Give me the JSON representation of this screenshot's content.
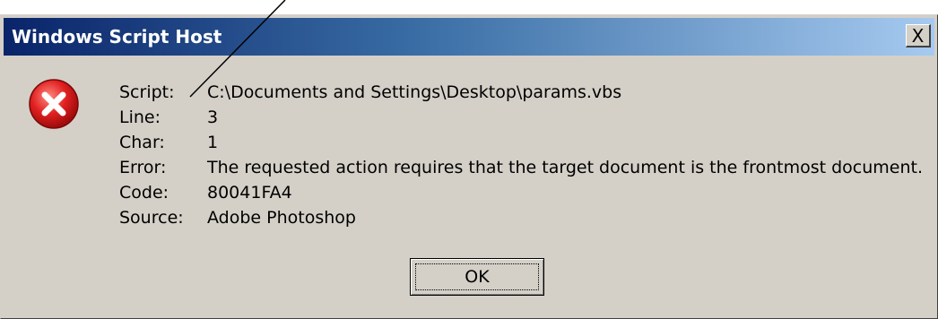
{
  "window": {
    "title": "Windows Script Host",
    "close_label": "X"
  },
  "icon": "error-icon",
  "details": [
    {
      "label": "Script:",
      "value": "C:\\Documents and Settings\\Desktop\\params.vbs"
    },
    {
      "label": "Line:",
      "value": "3"
    },
    {
      "label": "Char:",
      "value": "1"
    },
    {
      "label": "Error:",
      "value": "The requested action requires that the target document is the frontmost document."
    },
    {
      "label": "Code:",
      "value": "80041FA4"
    },
    {
      "label": "Source:",
      "value": "Adobe Photoshop"
    }
  ],
  "buttons": {
    "ok_label": "OK"
  },
  "colors": {
    "dialog_bg": "#d4d0c8",
    "title_gradient_start": "#0a246a",
    "title_gradient_end": "#a6caf0",
    "error_icon_red": "#d61a1a"
  }
}
